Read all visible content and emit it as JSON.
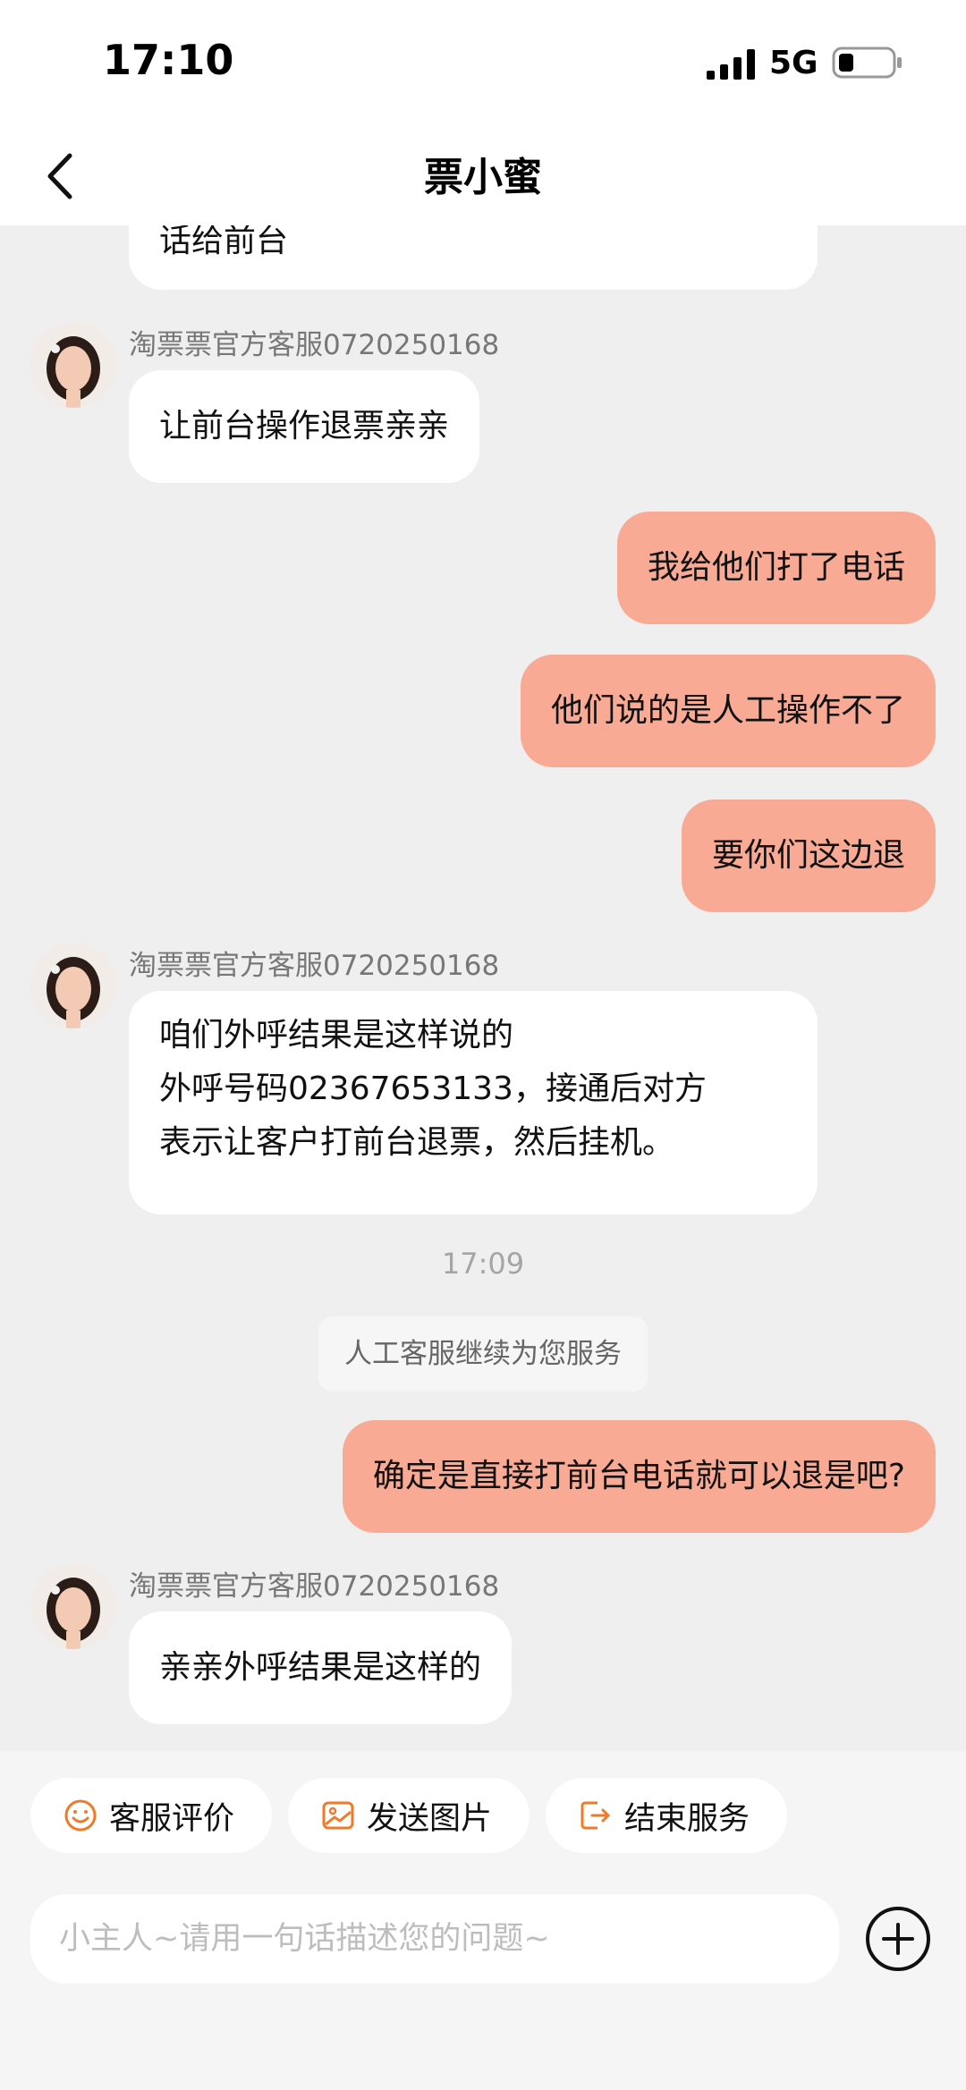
{
  "status_bar": {
    "time": "17:10",
    "network": "5G"
  },
  "nav": {
    "title": "票小蜜"
  },
  "messages": {
    "m0": {
      "text": "话给前台"
    },
    "m1": {
      "sender": "淘票票官方客服0720250168",
      "text": "让前台操作退票亲亲"
    },
    "m2": {
      "text": "我给他们打了电话"
    },
    "m3": {
      "text": "他们说的是人工操作不了"
    },
    "m4": {
      "text": "要你们这边退"
    },
    "m5": {
      "sender": "淘票票官方客服0720250168",
      "lines": [
        "咱们外呼结果是这样说的",
        "外呼号码02367653133，接通后对方",
        "表示让客户打前台退票，然后挂机。"
      ]
    },
    "time_sep": "17:09",
    "system": "人工客服继续为您服务",
    "m6": {
      "text": "确定是直接打前台电话就可以退是吧?"
    },
    "m7": {
      "sender": "淘票票官方客服0720250168",
      "text": "亲亲外呼结果是这样的"
    }
  },
  "quick_actions": {
    "rate": "客服评价",
    "image": "发送图片",
    "end": "结束服务"
  },
  "input": {
    "placeholder": "小主人~请用一句话描述您的问题~"
  },
  "colors": {
    "outgoing_bubble": "#f9aa94",
    "accent_icon": "#f07a2a"
  }
}
